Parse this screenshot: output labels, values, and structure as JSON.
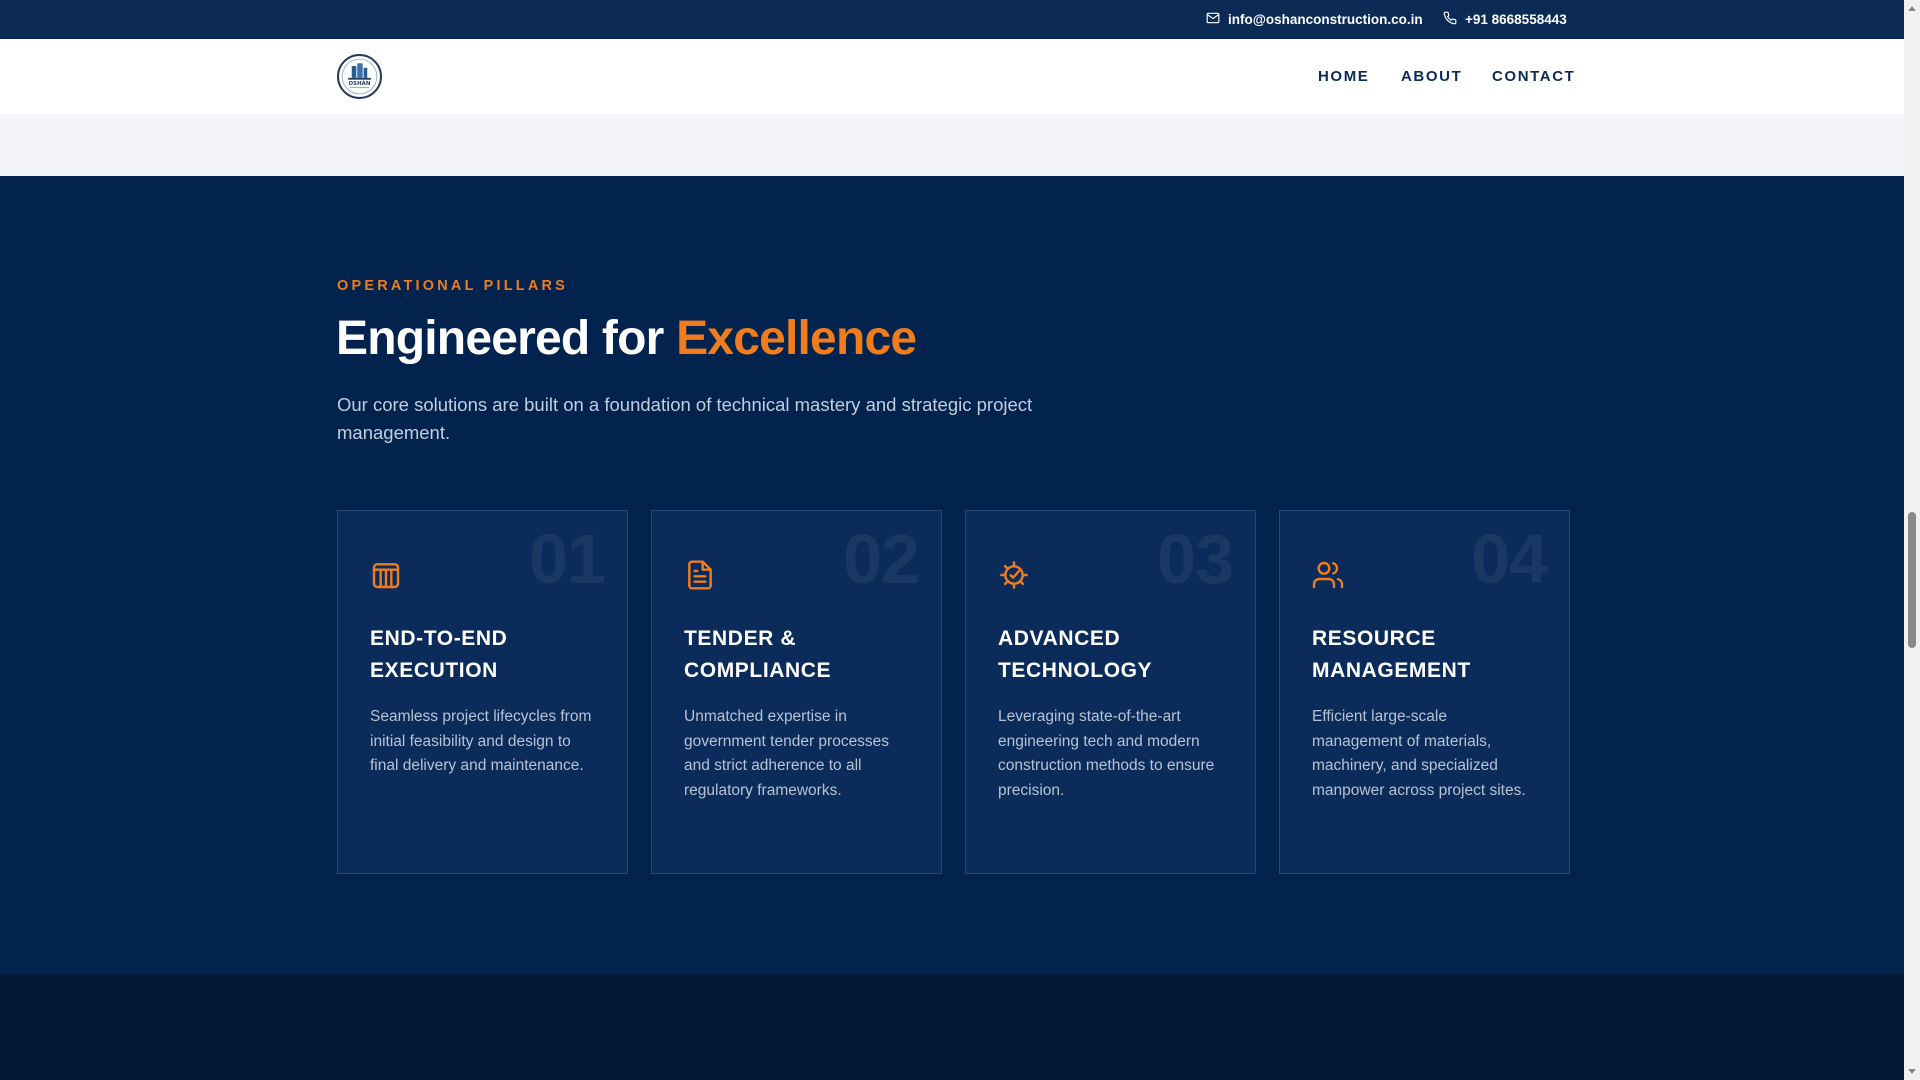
{
  "topbar": {
    "email": "info@oshanconstruction.co.in",
    "phone": "+91 8668558443"
  },
  "nav": {
    "logo_text": "OSHAN",
    "items": [
      "HOME",
      "ABOUT",
      "CONTACT"
    ]
  },
  "pillars": {
    "eyebrow": "OPERATIONAL PILLARS",
    "heading_main": "Engineered for",
    "heading_accent": "Excellence",
    "subtitle": "Our core solutions are built on a foundation of technical mastery and strategic project management.",
    "cards": [
      {
        "num": "01",
        "icon": "pillars-building-icon",
        "title": "End-to-End Execution",
        "desc": "Seamless project lifecycles from initial feasibility and design to final delivery and maintenance."
      },
      {
        "num": "02",
        "icon": "document-icon",
        "title": "Tender & Compliance",
        "desc": "Unmatched expertise in government tender processes and strict adherence to all regulatory frameworks."
      },
      {
        "num": "03",
        "icon": "gear-check-icon",
        "title": "Advanced Technology",
        "desc": "Leveraging state-of-the-art engineering tech and modern construction methods to ensure precision."
      },
      {
        "num": "04",
        "icon": "users-icon",
        "title": "Resource Management",
        "desc": "Efficient large-scale management of materials, machinery, and specialized manpower across project sites."
      }
    ]
  },
  "colors": {
    "navy": "#03234f",
    "accent": "#f07c1e",
    "card": "#0b2c5a"
  }
}
